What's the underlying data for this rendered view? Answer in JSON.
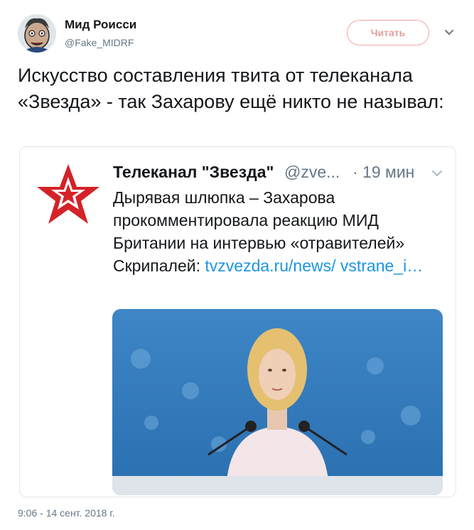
{
  "author": {
    "name": "Мид Роисси",
    "handle": "@Fake_MIDRF"
  },
  "follow_label": "Читать",
  "tweet_text": "Искусство составления твита от телеканала «Звезда» - так Захарову ещё никто не называл:",
  "quoted": {
    "name": "Телеканал \"Звезда\"",
    "handle": "@zve...",
    "time": "· 19 мин",
    "text": "Дырявая шлюпка – Захарова прокомментировала реакцию МИД Британии на интервью «отравителей» Скрипалей: ",
    "link": "tvzvezda.ru/news/ vstrane_i…"
  },
  "timestamp": "9:06 - 14 сент. 2018 г.",
  "colors": {
    "link": "#1b95e0",
    "follow_border": "#f5a3a3",
    "secondary_text": "#657786",
    "logo_red": "#d42228"
  }
}
